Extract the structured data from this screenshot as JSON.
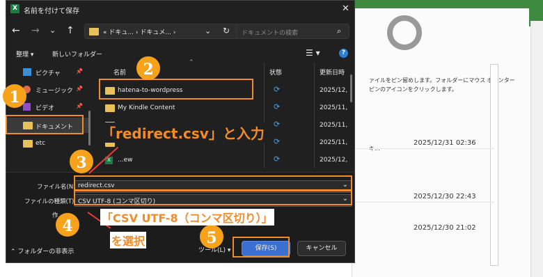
{
  "dialog": {
    "title": "名前を付けて保存",
    "app_icon": "excel-icon",
    "address": {
      "prefix": "«",
      "crumbs": [
        "ドキュ...",
        "ドキュメ..."
      ],
      "separator": "›"
    },
    "search_placeholder": "ドキュメントの検索",
    "toolbar": {
      "organize": "整理",
      "new_folder": "新しいフォルダー"
    },
    "sidebar": [
      {
        "label": "ピクチャ",
        "icon": "pictures-icon"
      },
      {
        "label": "ミュージック",
        "icon": "music-icon"
      },
      {
        "label": "ビデオ",
        "icon": "video-icon"
      },
      {
        "label": "ドキュメント",
        "icon": "folder-icon"
      },
      {
        "label": "etc",
        "icon": "folder-icon"
      }
    ],
    "columns": {
      "name": "名前",
      "status": "状態",
      "date": "更新日時"
    },
    "files": [
      {
        "name": "hatena-to-wordpress",
        "date": "2025/12,"
      },
      {
        "name": "My Kindle Content",
        "date": "2025/11,"
      },
      {
        "name": "",
        "date": "2025/11,"
      },
      {
        "name": "",
        "date": "2025/11,"
      },
      {
        "name": "...ew",
        "date": "2025/12,"
      }
    ],
    "filename_label": "ファイル名(N):",
    "filename_value": "redirect.csv",
    "filetype_label": "ファイルの種類(T):",
    "filetype_value": "CSV UTF-8 (コンマ区切り)",
    "author_label": "作",
    "hide_folders": "フォルダーの非表示",
    "tools": "ツール(L)",
    "save": "保存(S)",
    "cancel": "キャンセル"
  },
  "annotations": {
    "n1": "1",
    "n2": "2",
    "n3": "3",
    "n4": "4",
    "n5": "5",
    "text_redirect": "「redirect.csv」と入力",
    "text_csv_line1": "「CSV UTF-8（コンマ区切り）」",
    "text_csv_line2": "を選択"
  },
  "background": {
    "pin_text_1": "ァイルをピン留めします。フォルダーにマウス ポインター",
    "pin_text_2": "ピンのアイコンをクリックします。",
    "side_text": "キ...",
    "dates": [
      "2025/12/31 02:36",
      "2025/12/30 22:43",
      "2025/12/30 21:02"
    ]
  },
  "colors": {
    "accent": "#f28c28",
    "dialog_bg": "#202020",
    "excel_green": "#3e8a3e"
  }
}
